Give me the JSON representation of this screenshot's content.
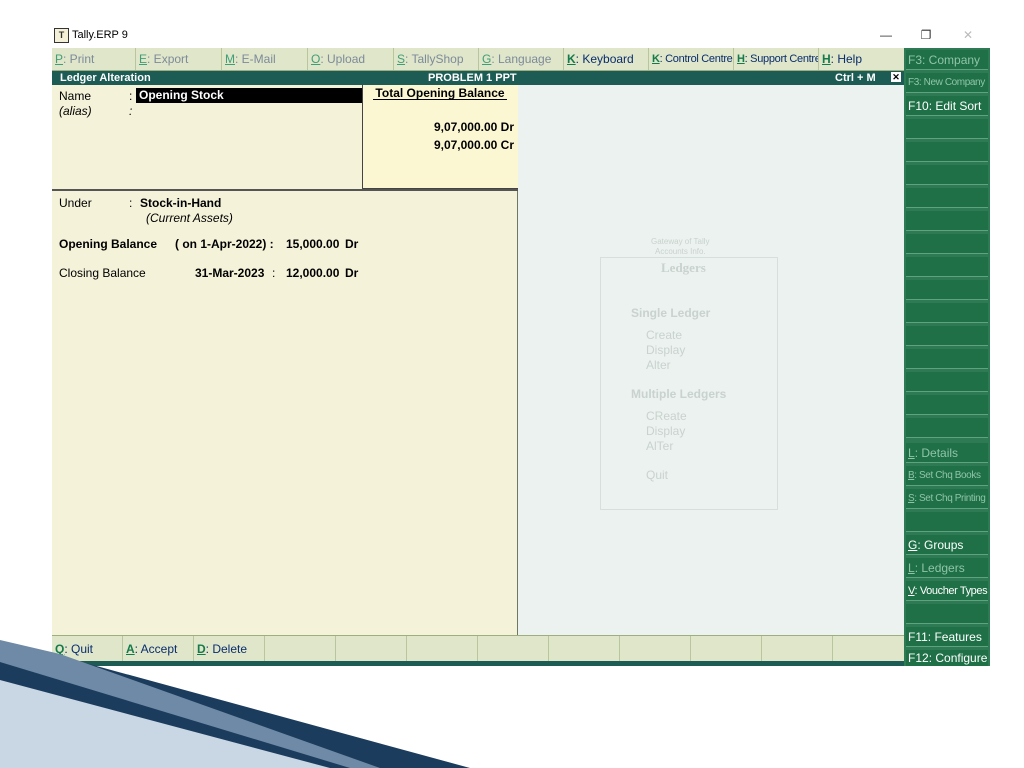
{
  "window": {
    "title": "Tally.ERP 9",
    "app_icon_text": "T",
    "minimize": "—",
    "restore": "❐",
    "close": "✕"
  },
  "top_menu": [
    {
      "key": "P",
      "label": ": Print",
      "state": "dim"
    },
    {
      "key": "E",
      "label": ": Export",
      "state": "dim"
    },
    {
      "key": "M",
      "label": ": E-Mail",
      "state": "dim"
    },
    {
      "key": "O",
      "label": ": Upload",
      "state": "dim"
    },
    {
      "key": "S",
      "label": ": TallyShop",
      "state": "dim"
    },
    {
      "key": "G",
      "label": ": Language",
      "state": "dim"
    },
    {
      "key": "K",
      "label": ": Keyboard",
      "state": "active"
    },
    {
      "key": "K",
      "label": ": Control Centre",
      "state": "active"
    },
    {
      "key": "H",
      "label": ": Support Centre",
      "state": "active"
    },
    {
      "key": "H",
      "label": ": Help",
      "state": "active"
    }
  ],
  "header": {
    "left": "Ledger Alteration",
    "center": "PROBLEM 1 PPT",
    "right": "Ctrl + M",
    "close": "✕"
  },
  "form": {
    "name_label": "Name",
    "name_colon": ":",
    "name_value": "Opening Stock",
    "alias_label": "(alias)",
    "alias_colon": ":",
    "total_opening_title": "Total Opening Balance",
    "total_dr": "9,07,000.00 Dr",
    "total_cr": "9,07,000.00 Cr",
    "under_label": "Under",
    "under_colon": ":",
    "under_value": "Stock-in-Hand",
    "under_group": "(Current Assets)",
    "opening_label": "Opening Balance",
    "opening_date": "( on 1-Apr-2022) :",
    "opening_amount": "15,000.00",
    "opening_type": "Dr",
    "closing_label": "Closing Balance",
    "closing_date": "31-Mar-2023",
    "closing_colon": ":",
    "closing_amount": "12,000.00",
    "closing_type": "Dr"
  },
  "ghost_menu": {
    "line1": "Gateway of Tally",
    "line2": "Accounts Info.",
    "title": "Ledgers",
    "single": "Single Ledger",
    "s_create": "Create",
    "s_display": "Display",
    "s_alter": "Alter",
    "multiple": "Multiple Ledgers",
    "m_create": "CReate",
    "m_display": "Display",
    "m_alter": "AlTer",
    "quit": "Quit"
  },
  "bottom_bar": [
    {
      "key": "Q",
      "label": ": Quit"
    },
    {
      "key": "A",
      "label": ": Accept"
    },
    {
      "key": "D",
      "label": ": Delete"
    }
  ],
  "right_panel": {
    "f3_company": {
      "key": "F3",
      "label": ": Company"
    },
    "f3_new_company": {
      "key": "F3",
      "label": ": New Company"
    },
    "f10_edit_sort": {
      "key": "F10",
      "label": ": Edit Sort"
    },
    "l_details": {
      "key": "L",
      "label": ": Details"
    },
    "b_set_chq_books": {
      "key": "B",
      "label": ": Set Chq Books"
    },
    "s_set_chq_printing": {
      "key": "S",
      "label": ": Set Chq Printing"
    },
    "g_groups": {
      "key": "G",
      "label": ": Groups"
    },
    "l_ledgers": {
      "key": "L",
      "label": ": Ledgers"
    },
    "v_voucher_types": {
      "key": "V",
      "label": ": Voucher Types"
    },
    "f11_features": {
      "key": "F11",
      "label": ": Features"
    },
    "f12_configure": {
      "key": "F12",
      "label": ": Configure"
    }
  },
  "colors": {
    "header_bg": "#1d5c55",
    "form_bg": "#f4f2d9",
    "menu_bg": "#dfe6c9",
    "panel_bg": "#2d7a55",
    "key_green": "#147a4a",
    "swoosh_dark": "#1c3c5e"
  }
}
